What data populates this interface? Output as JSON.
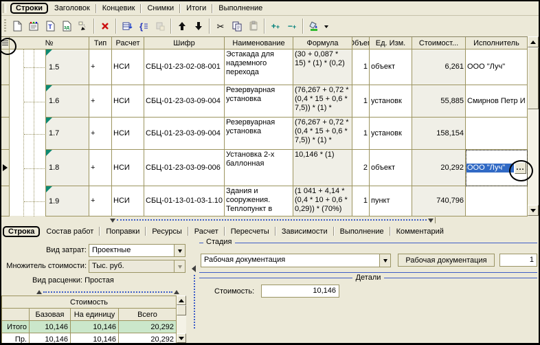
{
  "tabs_top": {
    "items": [
      "Строки",
      "Заголовок",
      "Концевик",
      "Снимки",
      "Итоги",
      "Выполнение"
    ],
    "active": "Строки"
  },
  "toolbar": {
    "icons": [
      "new-document",
      "notebook",
      "text-document",
      "document-template",
      "goto-cell",
      "delete",
      "insert-rows",
      "formula-braces",
      "paste-special",
      "move-up",
      "move-down",
      "cut",
      "copy",
      "paste",
      "add-plus",
      "minus-plus",
      "fill-color",
      "fill-color-dropdown"
    ],
    "cut_glyph": "✂"
  },
  "grid": {
    "columns": [
      "№",
      "Тип",
      "Расчет",
      "Шифр",
      "Наименование",
      "Формула",
      "Объем",
      "Ед. Изм.",
      "Стоимост...",
      "Исполнитель"
    ],
    "ellipsis_button": "...",
    "rows": [
      {
        "num": "1.5",
        "type": "+",
        "calc": "НСИ",
        "code": "СБЦ-01-23-02-08-001",
        "name": "Эстакада для надземного перехода",
        "formula": "(30 + 0,087 * 15) * (1) * (0,2)",
        "volume": "1",
        "unit": "объект",
        "cost": "6,261",
        "executor": "ООО \"Луч\""
      },
      {
        "num": "1.6",
        "type": "+",
        "calc": "НСИ",
        "code": "СБЦ-01-23-03-09-004",
        "name": "Резервуарная установка",
        "formula": "(76,267 + 0,72 * (0,4 * 15 + 0,6 * 7,5)) * (1) *",
        "volume": "1",
        "unit": "установк",
        "cost": "55,885",
        "executor": "Смирнов Петр И"
      },
      {
        "num": "1.7",
        "type": "+",
        "calc": "НСИ",
        "code": "СБЦ-01-23-03-09-004",
        "name": "Резервуарная установка",
        "formula": "(76,267 + 0,72 * (0,4 * 15 + 0,6 * 7,5)) * (1) *",
        "volume": "1",
        "unit": "установк",
        "cost": "158,154",
        "executor": ""
      },
      {
        "num": "1.8",
        "type": "+",
        "calc": "НСИ",
        "code": "СБЦ-01-23-03-09-006",
        "name": "Установка 2-х баллонная",
        "formula": "10,146 * (1)",
        "volume": "2",
        "unit": "объект",
        "cost": "20,292",
        "executor": "ООО \"Луч\""
      },
      {
        "num": "1.9",
        "type": "+",
        "calc": "НСИ",
        "code": "СБЦ-01-13-01-03-1.10",
        "name": "Здания и сооружения. Теплопункт в",
        "formula": "(1 041 + 4,14 * (0,4 * 10 + 0,6 * 0,29)) * (70%)",
        "volume": "1",
        "unit": "пункт",
        "cost": "740,796",
        "executor": ""
      }
    ]
  },
  "tabs_bottom": {
    "items": [
      "Строка",
      "Состав работ",
      "Поправки",
      "Ресурсы",
      "Расчет",
      "Пересчеты",
      "Зависимости",
      "Выполнение",
      "Комментарий"
    ],
    "active": "Строка"
  },
  "panel": {
    "cost_type_label": "Вид затрат:",
    "cost_type_value": "Проектные",
    "multiplier_label": "Множитель стоимости:",
    "multiplier_value": "Тыс. руб.",
    "rate_label": "Вид расценки:",
    "rate_value": "Простая",
    "cost_table": {
      "title": "Стоимость",
      "columns": [
        "Базовая",
        "На единицу",
        "Всего"
      ],
      "rows": [
        {
          "label": "Итого",
          "base": "10,146",
          "per_unit": "10,146",
          "total": "20,292"
        },
        {
          "label": "Пр.",
          "base": "10,146",
          "per_unit": "10,146",
          "total": "20,292"
        }
      ]
    },
    "stage": {
      "title": "Стадия",
      "selected": "Рабочая документация",
      "name": "Рабочая документация",
      "number": "1"
    },
    "details": {
      "title": "Детали",
      "cost_label": "Стоимость:",
      "cost_value": "10,146"
    }
  }
}
